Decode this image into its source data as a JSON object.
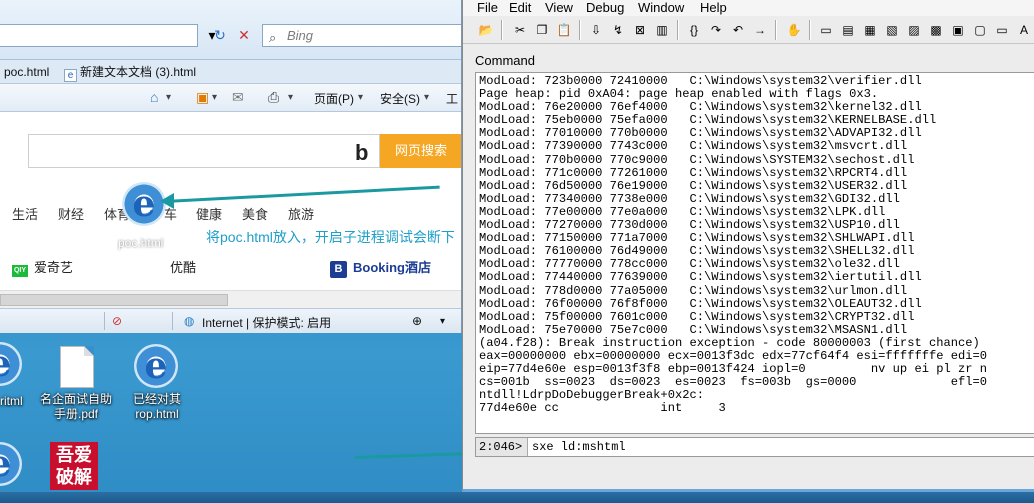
{
  "browser": {
    "search_placeholder": "Bing",
    "tabs": [
      "poc.html",
      "新建文本文档 (3).html"
    ],
    "commands": [
      "页面(P)",
      "安全(S)",
      "工"
    ],
    "search_button": "网页搜索",
    "nav_links": [
      "生活",
      "财经",
      "体育",
      "车",
      "健康",
      "美食",
      "旅游"
    ],
    "row_links": {
      "iqiyi": "爱奇艺",
      "iqiyi_badge": "QIY",
      "youhui": "优酷",
      "booking": "Booking酒店"
    },
    "status": {
      "zone": "Internet | 保护模式: 启用"
    },
    "dragged_file": "poc.html",
    "hint_text": "将poc.html放入，开启子进程调试会断下"
  },
  "desktop": {
    "icons": [
      {
        "label": "ritml"
      },
      {
        "label": "名企面试自助手册.pdf"
      },
      {
        "label": "已经对其rop.html"
      },
      {
        "label": "吾爱破解"
      }
    ]
  },
  "windbg": {
    "menu": [
      "File",
      "Edit",
      "View",
      "Debug",
      "Window",
      "Help"
    ],
    "command_title": "Command",
    "output": "ModLoad: 723b0000 72410000   C:\\Windows\\system32\\verifier.dll\nPage heap: pid 0xA04: page heap enabled with flags 0x3.\nModLoad: 76e20000 76ef4000   C:\\Windows\\system32\\kernel32.dll\nModLoad: 75eb0000 75efa000   C:\\Windows\\system32\\KERNELBASE.dll\nModLoad: 77010000 770b0000   C:\\Windows\\system32\\ADVAPI32.dll\nModLoad: 77390000 7743c000   C:\\Windows\\system32\\msvcrt.dll\nModLoad: 770b0000 770c9000   C:\\Windows\\SYSTEM32\\sechost.dll\nModLoad: 771c0000 77261000   C:\\Windows\\system32\\RPCRT4.dll\nModLoad: 76d50000 76e19000   C:\\Windows\\system32\\USER32.dll\nModLoad: 77340000 7738e000   C:\\Windows\\system32\\GDI32.dll\nModLoad: 77e00000 77e0a000   C:\\Windows\\system32\\LPK.dll\nModLoad: 77270000 7730d000   C:\\Windows\\system32\\USP10.dll\nModLoad: 77150000 771a7000   C:\\Windows\\system32\\SHLWAPI.dll\nModLoad: 76100000 76d49000   C:\\Windows\\system32\\SHELL32.dll\nModLoad: 77770000 778cc000   C:\\Windows\\system32\\ole32.dll\nModLoad: 77440000 77639000   C:\\Windows\\system32\\iertutil.dll\nModLoad: 778d0000 77a05000   C:\\Windows\\system32\\urlmon.dll\nModLoad: 76f00000 76f8f000   C:\\Windows\\system32\\OLEAUT32.dll\nModLoad: 75f00000 7601c000   C:\\Windows\\system32\\CRYPT32.dll\nModLoad: 75e70000 75e7c000   C:\\Windows\\system32\\MSASN1.dll\n(a04.f28): Break instruction exception - code 80000003 (first chance)\neax=00000000 ebx=00000000 ecx=0013f3dc edx=77cf64f4 esi=fffffffe edi=0\neip=77d4e60e esp=0013f3f8 ebp=0013f424 iopl=0         nv up ei pl zr n\ncs=001b  ss=0023  ds=0023  es=0023  fs=003b  gs=0000             efl=0\nntdll!LdrpDoDebuggerBreak+0x2c:\n77d4e60e cc              int     3",
    "prompt": "2:046>",
    "command_input": "sxe ld:mshtml"
  }
}
